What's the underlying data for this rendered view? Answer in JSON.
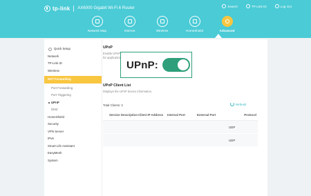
{
  "brand": {
    "name": "tp-link",
    "model": "AX6000 Gigabit Wi-Fi 6 Router"
  },
  "top_links": [
    {
      "label": "Search",
      "icon": "search-icon"
    },
    {
      "label": "TP-Link ID",
      "icon": "user-icon"
    },
    {
      "label": "Log Out",
      "icon": "logout-icon"
    }
  ],
  "nav": [
    {
      "label": "Network Map",
      "icon": "network-map-icon"
    },
    {
      "label": "Internet",
      "icon": "globe-icon"
    },
    {
      "label": "Wireless",
      "icon": "wifi-icon"
    },
    {
      "label": "HomeShield",
      "icon": "house-icon"
    },
    {
      "label": "Advanced",
      "icon": "gear-icon",
      "active": true
    }
  ],
  "sidebar": {
    "quick_setup": "Quick Setup",
    "items": [
      "Network",
      "TP-Link ID",
      "Wireless"
    ],
    "active": "NAT Forwarding",
    "sub_items": [
      "Port Forwarding",
      "Port Triggering"
    ],
    "current_sub": "UPnP",
    "sub_items_after": [
      "DMZ"
    ],
    "items_after": [
      "HomeShield",
      "Security",
      "VPN Server",
      "IPv6",
      "Smart Life Assistant",
      "EasyMesh",
      "System"
    ]
  },
  "upnp": {
    "title": "UPnP",
    "desc_line1": "Enable UPnP ... local network to dynamically open ports",
    "desc_line2": "for applications ... connections.",
    "callout_label": "UPnP:",
    "enabled": true
  },
  "client_list": {
    "title": "UPnP Client List",
    "desc": "Displays the UPnP device information.",
    "total": "Total Clients: 2",
    "refresh": "Refresh",
    "columns": [
      "Service Description",
      "Client IP Address",
      "Internal Port",
      "External Port",
      "Protocol"
    ],
    "rows": [
      [
        "",
        "",
        "",
        "",
        "UDP"
      ],
      [
        "",
        "",
        "",
        "",
        "UDP"
      ]
    ]
  },
  "colors": {
    "header": "#4acbd6",
    "accent": "#f9c640",
    "toggle": "#2e9f7a",
    "link": "#33b7c6"
  }
}
